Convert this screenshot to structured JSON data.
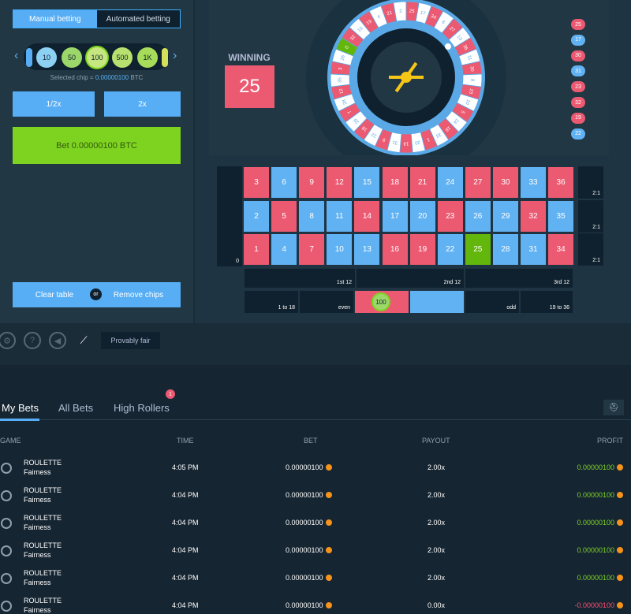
{
  "tabs": {
    "manual": "Manual betting",
    "auto": "Automated betting"
  },
  "chips": [
    "10",
    "50",
    "100",
    "500",
    "1K"
  ],
  "selected_chip": {
    "label": "Selected chip = ",
    "value": "0.00000100",
    "unit": "BTC"
  },
  "buttons": {
    "half": "1/2x",
    "double": "2x",
    "bet": "Bet 0.00000100 BTC",
    "clear": "Clear table",
    "or": "or",
    "remove": "Remove chips"
  },
  "winning": {
    "label": "WINNING",
    "number": "25"
  },
  "wheel_numbers": [
    "0",
    "32",
    "15",
    "19",
    "4",
    "21",
    "2",
    "25",
    "17",
    "34",
    "6",
    "27",
    "13",
    "36",
    "11",
    "30",
    "8",
    "23",
    "10",
    "5",
    "24",
    "16",
    "33",
    "1",
    "20",
    "14",
    "31",
    "9",
    "22",
    "18",
    "29",
    "7",
    "28",
    "12",
    "35",
    "3",
    "26"
  ],
  "history": [
    {
      "n": "25",
      "c": "red"
    },
    {
      "n": "17",
      "c": "blue"
    },
    {
      "n": "30",
      "c": "red"
    },
    {
      "n": "31",
      "c": "blue"
    },
    {
      "n": "23",
      "c": "red"
    },
    {
      "n": "32",
      "c": "red"
    },
    {
      "n": "19",
      "c": "red"
    },
    {
      "n": "22",
      "c": "blue"
    }
  ],
  "board": {
    "zero": "0",
    "rows": [
      [
        "3",
        "6",
        "9",
        "12",
        "15",
        "18",
        "21",
        "24",
        "27",
        "30",
        "33",
        "36"
      ],
      [
        "2",
        "5",
        "8",
        "11",
        "14",
        "17",
        "20",
        "23",
        "26",
        "29",
        "32",
        "35"
      ],
      [
        "1",
        "4",
        "7",
        "10",
        "13",
        "16",
        "19",
        "22",
        "25",
        "28",
        "31",
        "34"
      ]
    ],
    "red_numbers": [
      "1",
      "3",
      "5",
      "7",
      "9",
      "12",
      "14",
      "16",
      "18",
      "19",
      "21",
      "23",
      "25",
      "27",
      "30",
      "32",
      "34",
      "36"
    ],
    "highlight": "25",
    "column_label": "2:1",
    "dozens": [
      "1st 12",
      "2nd 12",
      "3rd 12"
    ],
    "outside": [
      "1 to 18",
      "even",
      "",
      "",
      "odd",
      "19 to 36"
    ],
    "placed_chip": "100"
  },
  "controls": {
    "provably_fair": "Provably fair"
  },
  "bets_tabs": [
    "My Bets",
    "All Bets",
    "High Rollers"
  ],
  "high_rollers_badge": "1",
  "columns": [
    "GAME",
    "TIME",
    "BET",
    "PAYOUT",
    "PROFIT"
  ],
  "rows": [
    {
      "game": "ROULETTE",
      "sub": "Fairness",
      "time": "4:05 PM",
      "bet": "0.00000100",
      "payout": "2.00x",
      "profit": "0.00000100",
      "sign": "pos"
    },
    {
      "game": "ROULETTE",
      "sub": "Fairness",
      "time": "4:04 PM",
      "bet": "0.00000100",
      "payout": "2.00x",
      "profit": "0.00000100",
      "sign": "pos"
    },
    {
      "game": "ROULETTE",
      "sub": "Fairness",
      "time": "4:04 PM",
      "bet": "0.00000100",
      "payout": "2.00x",
      "profit": "0.00000100",
      "sign": "pos"
    },
    {
      "game": "ROULETTE",
      "sub": "Fairness",
      "time": "4:04 PM",
      "bet": "0.00000100",
      "payout": "2.00x",
      "profit": "0.00000100",
      "sign": "pos"
    },
    {
      "game": "ROULETTE",
      "sub": "Fairness",
      "time": "4:04 PM",
      "bet": "0.00000100",
      "payout": "2.00x",
      "profit": "0.00000100",
      "sign": "pos"
    },
    {
      "game": "ROULETTE",
      "sub": "Fairness",
      "time": "4:04 PM",
      "bet": "0.00000100",
      "payout": "0.00x",
      "profit": "-0.00000100",
      "sign": "neg"
    }
  ]
}
